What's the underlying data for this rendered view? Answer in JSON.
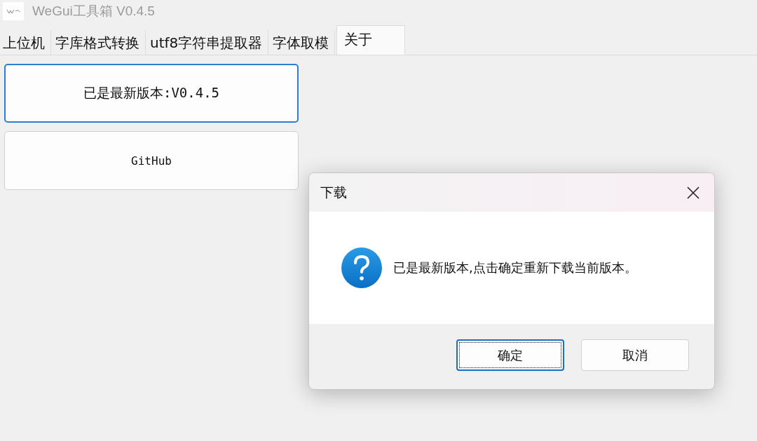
{
  "window": {
    "title": "WeGui工具箱 V0.4.5"
  },
  "tabs": [
    {
      "label": "上位机",
      "selected": false
    },
    {
      "label": "字库格式转换",
      "selected": false
    },
    {
      "label": "utf8字符串提取器",
      "selected": false
    },
    {
      "label": "字体取模",
      "selected": false
    },
    {
      "label": "关于",
      "selected": true
    }
  ],
  "buttons": [
    {
      "label": "已是最新版本:V0.4.5",
      "focused": true
    },
    {
      "label": "GitHub",
      "focused": false
    }
  ],
  "dialog": {
    "title": "下载",
    "message": "已是最新版本,点击确定重新下载当前版本。",
    "buttons": [
      {
        "label": "确定",
        "focused": true
      },
      {
        "label": "取消",
        "focused": false
      }
    ]
  }
}
